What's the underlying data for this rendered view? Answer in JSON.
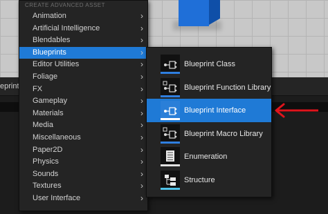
{
  "menu": {
    "header": "CREATE ADVANCED ASSET",
    "items": [
      {
        "label": "Animation"
      },
      {
        "label": "Artificial Intelligence"
      },
      {
        "label": "Blendables"
      },
      {
        "label": "Blueprints"
      },
      {
        "label": "Editor Utilities"
      },
      {
        "label": "Foliage"
      },
      {
        "label": "FX"
      },
      {
        "label": "Gameplay"
      },
      {
        "label": "Materials"
      },
      {
        "label": "Media"
      },
      {
        "label": "Miscellaneous"
      },
      {
        "label": "Paper2D"
      },
      {
        "label": "Physics"
      },
      {
        "label": "Sounds"
      },
      {
        "label": "Textures"
      },
      {
        "label": "User Interface"
      }
    ],
    "active_index": 3,
    "chevron": "›"
  },
  "submenu": {
    "items": [
      {
        "label": "Blueprint Class",
        "icon": "blueprint-class-icon"
      },
      {
        "label": "Blueprint Function Library",
        "icon": "blueprint-function-library-icon"
      },
      {
        "label": "Blueprint Interface",
        "icon": "blueprint-interface-icon"
      },
      {
        "label": "Blueprint Macro Library",
        "icon": "blueprint-macro-library-icon"
      },
      {
        "label": "Enumeration",
        "icon": "enumeration-icon"
      },
      {
        "label": "Structure",
        "icon": "structure-icon"
      }
    ],
    "active_index": 2
  },
  "background": {
    "edge_text": "eprint"
  },
  "colors": {
    "accent": "#1f7ad6",
    "arrow": "#e0141c",
    "cube": "#1f6fd8"
  }
}
